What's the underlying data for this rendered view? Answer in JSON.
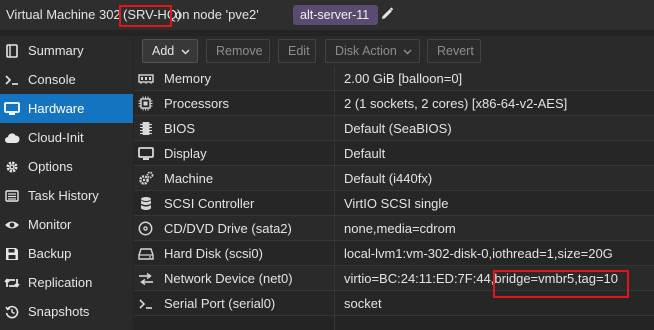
{
  "header": {
    "prefix": "Virtual Machine 302",
    "vm_name": "(SRV-HQ)",
    "suffix": "on node 'pve2'",
    "tag": "alt-server-11",
    "edit_icon": "pencil-icon"
  },
  "sidebar": {
    "items": [
      {
        "label": "Summary",
        "icon": "book-icon"
      },
      {
        "label": "Console",
        "icon": "terminal-icon"
      },
      {
        "label": "Hardware",
        "icon": "monitor-icon",
        "active": true
      },
      {
        "label": "Cloud-Init",
        "icon": "cloud-icon"
      },
      {
        "label": "Options",
        "icon": "gear-icon"
      },
      {
        "label": "Task History",
        "icon": "list-icon"
      },
      {
        "label": "Monitor",
        "icon": "eye-icon"
      },
      {
        "label": "Backup",
        "icon": "floppy-icon"
      },
      {
        "label": "Replication",
        "icon": "retweet-icon"
      },
      {
        "label": "Snapshots",
        "icon": "history-icon"
      }
    ]
  },
  "toolbar": {
    "add": "Add",
    "remove": "Remove",
    "edit": "Edit",
    "disk_action": "Disk Action",
    "revert": "Revert"
  },
  "hardware": {
    "rows": [
      {
        "name": "Memory",
        "value": "2.00 GiB [balloon=0]",
        "icon": "memory-icon"
      },
      {
        "name": "Processors",
        "value": "2 (1 sockets, 2 cores) [x86-64-v2-AES]",
        "icon": "cpu-icon"
      },
      {
        "name": "BIOS",
        "value": "Default (SeaBIOS)",
        "icon": "chip-icon"
      },
      {
        "name": "Display",
        "value": "Default",
        "icon": "desktop-icon"
      },
      {
        "name": "Machine",
        "value": "Default (i440fx)",
        "icon": "cogs-icon"
      },
      {
        "name": "SCSI Controller",
        "value": "VirtIO SCSI single",
        "icon": "database-icon"
      },
      {
        "name": "CD/DVD Drive (sata2)",
        "value": "none,media=cdrom",
        "icon": "disc-icon"
      },
      {
        "name": "Hard Disk (scsi0)",
        "value": "local-lvm1:vm-302-disk-0,iothread=1,size=20G",
        "icon": "hdd-icon"
      },
      {
        "name": "Network Device (net0)",
        "value": "virtio=BC:24:11:ED:7F:44,bridge=vmbr5,tag=10",
        "icon": "network-icon"
      },
      {
        "name": "Serial Port (serial0)",
        "value": "socket",
        "icon": "terminal-icon"
      }
    ]
  },
  "colors": {
    "accent": "#1474c0",
    "highlight": "#e0161e",
    "tag_bg": "#5b4a72"
  }
}
